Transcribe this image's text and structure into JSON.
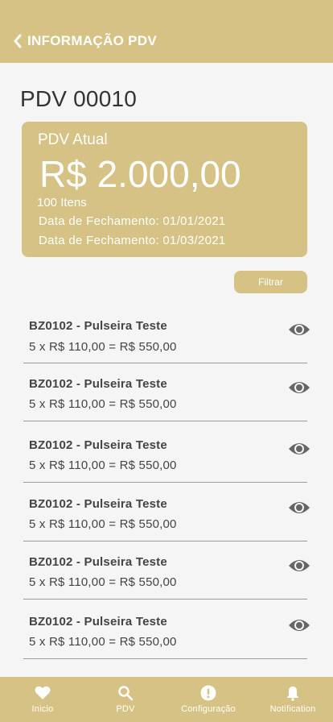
{
  "header": {
    "title": "INFORMAÇÃO PDV"
  },
  "page": {
    "title": "PDV 00010"
  },
  "card": {
    "label": "PDV Atual",
    "amount": "R$ 2.000,00",
    "items": "100 Itens",
    "date1": "Data de Fechamento: 01/01/2021",
    "date2": "Data de Fechamento: 01/03/2021"
  },
  "filter": {
    "label": "Filtrar"
  },
  "items": [
    {
      "name": "BZ0102 - Pulseira Teste",
      "calc": "5 x R$ 110,00 = R$ 550,00"
    },
    {
      "name": "BZ0102 - Pulseira Teste",
      "calc": "5 x R$ 110,00 = R$ 550,00"
    },
    {
      "name": "BZ0102 - Pulseira Teste",
      "calc": "5 x R$ 110,00 = R$ 550,00"
    },
    {
      "name": "BZ0102 - Pulseira Teste",
      "calc": "5 x R$ 110,00 = R$ 550,00"
    },
    {
      "name": "BZ0102 - Pulseira Teste",
      "calc": "5 x R$ 110,00 = R$ 550,00"
    },
    {
      "name": "BZ0102 - Pulseira Teste",
      "calc": "5 x R$ 110,00 = R$ 550,00"
    }
  ],
  "tabbar": {
    "tabs": [
      {
        "label": "Inicio",
        "icon": "heart-icon"
      },
      {
        "label": "PDV",
        "icon": "search-icon"
      },
      {
        "label": "Configuração",
        "icon": "alert-icon"
      },
      {
        "label": "Notification",
        "icon": "bell-icon"
      }
    ]
  },
  "colors": {
    "accent": "#d6c284",
    "text": "#444444",
    "background": "#f5f5f5"
  }
}
